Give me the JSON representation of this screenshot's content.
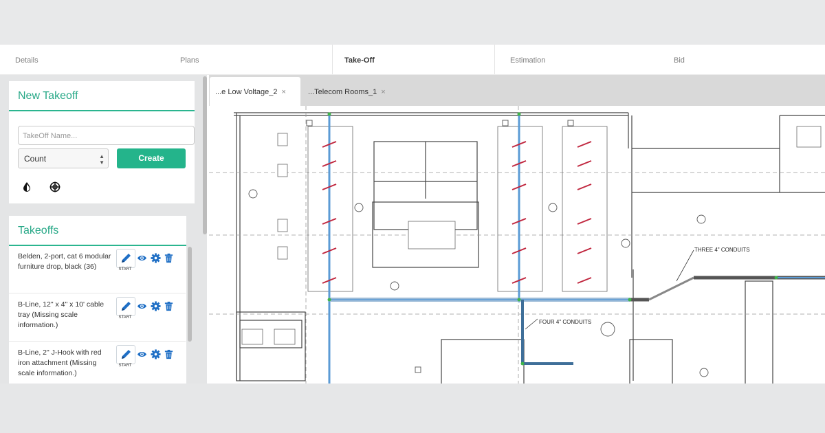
{
  "nav": {
    "tabs": [
      {
        "label": "Details"
      },
      {
        "label": "Plans"
      },
      {
        "label": "Take-Off"
      },
      {
        "label": "Estimation"
      },
      {
        "label": "Bid"
      }
    ],
    "active_tab": "Take-Off"
  },
  "new_takeoff": {
    "title": "New Takeoff",
    "name_placeholder": "TakeOff Name...",
    "type_value": "Count",
    "create_label": "Create",
    "tool_icons": [
      "water-drop-icon",
      "crosshair-icon"
    ]
  },
  "takeoffs": {
    "title": "Takeoffs",
    "start_label": "START",
    "items": [
      {
        "description": "Belden, 2-port, cat 6 modular furniture drop, black (36)"
      },
      {
        "description": "B-Line, 12\" x 4\" x 10' cable tray (Missing scale information.)"
      },
      {
        "description": "B-Line, 2\" J-Hook with red iron attachment (Missing scale information.)"
      }
    ],
    "item_icons": [
      "pencil-icon",
      "eye-icon",
      "gear-icon",
      "trash-icon"
    ]
  },
  "document_tabs": [
    {
      "label": "...e Low Voltage_2",
      "close": "×"
    },
    {
      "label": "...Telecom Rooms_1",
      "close": "×"
    }
  ],
  "plan_annotations": {
    "three_conduits": "THREE 4\" CONDUITS",
    "four_conduits": "FOUR 4\" CONDUITS"
  },
  "colors": {
    "accent": "#24b48b",
    "accent_text": "#27a887",
    "icon_blue": "#1f6fc5",
    "conduit_blue": "#5b9bd5",
    "marker_red": "#c0263e",
    "marker_green": "#3fb54a"
  }
}
